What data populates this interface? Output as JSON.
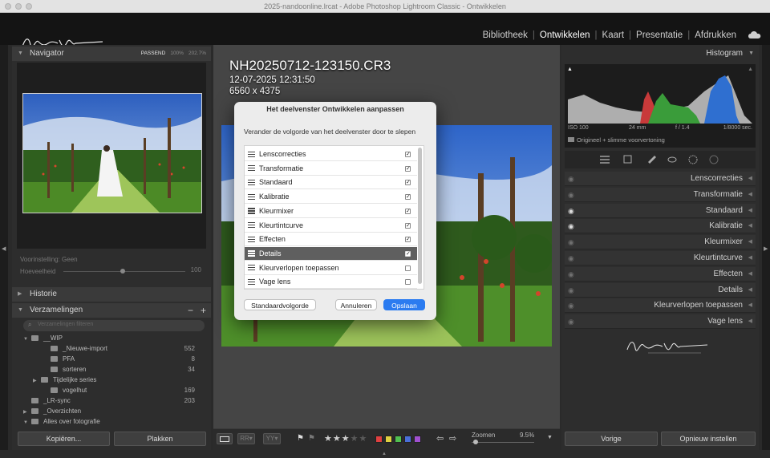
{
  "window": {
    "title": "2025-nandoonline.lrcat - Adobe Photoshop Lightroom Classic - Ontwikkelen"
  },
  "modules": [
    {
      "label": "Bibliotheek",
      "active": false
    },
    {
      "label": "Ontwikkelen",
      "active": true
    },
    {
      "label": "Kaart",
      "active": false
    },
    {
      "label": "Presentatie",
      "active": false
    },
    {
      "label": "Afdrukken",
      "active": false
    }
  ],
  "navigator": {
    "title": "Navigator",
    "zoom_options": [
      "PASSEND",
      "100%",
      "202.7%"
    ]
  },
  "left_panel": {
    "preset_label": "Voorinstelling: Geen",
    "amount_label": "Hoeveelheid",
    "amount_value": "100",
    "history_title": "Historie",
    "collections_title": "Verzamelingen",
    "search_placeholder": "Verzamelingen filteren",
    "collections": [
      {
        "name": "__WIP",
        "count": "",
        "expanded": true
      },
      {
        "name": "_Nieuwe-import",
        "count": "552"
      },
      {
        "name": "PFA",
        "count": "8"
      },
      {
        "name": "sorteren",
        "count": "34"
      },
      {
        "name": "Tijdelijke series",
        "count": ""
      },
      {
        "name": "vogelhut",
        "count": "169"
      },
      {
        "name": "_LR-sync",
        "count": "203"
      },
      {
        "name": "_Overzichten",
        "count": ""
      },
      {
        "name": "Alles over fotografie",
        "count": ""
      }
    ],
    "copy_label": "Kopiëren...",
    "paste_label": "Plakken"
  },
  "image_info": {
    "filename": "NH20250712-123150.CR3",
    "datetime": "12-07-2025 12:31:50",
    "dimensions": "6560 x 4375"
  },
  "dialog": {
    "title": "Het deelvenster Ontwikkelen aanpassen",
    "instruction": "Verander de volgorde van het deelvenster door te slepen",
    "items": [
      {
        "label": "Lenscorrecties",
        "checked": true,
        "selected": false
      },
      {
        "label": "Transformatie",
        "checked": true,
        "selected": false
      },
      {
        "label": "Standaard",
        "checked": true,
        "selected": false
      },
      {
        "label": "Kalibratie",
        "checked": true,
        "selected": false
      },
      {
        "label": "Kleurmixer",
        "checked": true,
        "selected": false
      },
      {
        "label": "Kleurtintcurve",
        "checked": true,
        "selected": false
      },
      {
        "label": "Effecten",
        "checked": true,
        "selected": false
      },
      {
        "label": "Details",
        "checked": true,
        "selected": true
      },
      {
        "label": "Kleurverlopen toepassen",
        "checked": false,
        "selected": false
      },
      {
        "label": "Vage lens",
        "checked": false,
        "selected": false
      }
    ],
    "default_order_label": "Standaardvolgorde",
    "cancel_label": "Annuleren",
    "save_label": "Opslaan"
  },
  "histogram": {
    "title": "Histogram",
    "iso": "ISO 100",
    "focal": "24 mm",
    "aperture": "f / 1.4",
    "shutter": "1/8000 sec.",
    "preview_label": "Origineel + slimme voorvertoning"
  },
  "right_panels": [
    {
      "label": "Lenscorrecties",
      "eye_on": false
    },
    {
      "label": "Transformatie",
      "eye_on": false
    },
    {
      "label": "Standaard",
      "eye_on": true
    },
    {
      "label": "Kalibratie",
      "eye_on": true
    },
    {
      "label": "Kleurmixer",
      "eye_on": false
    },
    {
      "label": "Kleurtintcurve",
      "eye_on": false
    },
    {
      "label": "Effecten",
      "eye_on": false
    },
    {
      "label": "Details",
      "eye_on": false
    },
    {
      "label": "Kleurverlopen toepassen",
      "eye_on": false
    },
    {
      "label": "Vage lens",
      "eye_on": false
    }
  ],
  "right_footer": {
    "previous_label": "Vorige",
    "reset_label": "Opnieuw instellen"
  },
  "toolbar": {
    "zoom_label": "Zoomen",
    "zoom_value": "9.5%",
    "rating": 3,
    "color_labels": [
      "#e04040",
      "#e0d040",
      "#50c050",
      "#4a6fd8",
      "#a050d0"
    ]
  },
  "colors": {
    "accent": "#2b7bf0",
    "selection": "#5f5f5f"
  }
}
